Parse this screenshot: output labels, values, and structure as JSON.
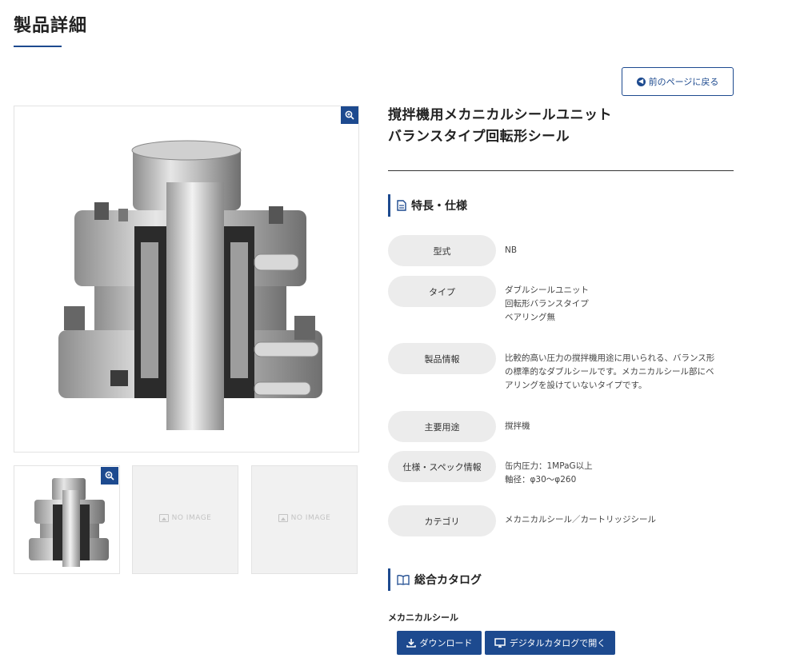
{
  "page": {
    "title": "製品詳細"
  },
  "back_button": {
    "label": "前のページに戻る"
  },
  "images": {
    "no_image_label": "NO IMAGE"
  },
  "product": {
    "name_line1": "撹拌機用メカニカルシールユニット",
    "name_line2": "バランスタイプ回転形シール"
  },
  "features": {
    "heading": "特長・仕様",
    "rows": [
      {
        "label": "型式",
        "value": "NB"
      },
      {
        "label": "タイプ",
        "value": "ダブルシールユニット\n回転形バランスタイプ\nベアリング無"
      },
      {
        "label": "製品情報",
        "value": "比較的高い圧力の撹拌機用途に用いられる、バランス形\nの標準的なダブルシールです。メカニカルシール部にベ\nアリングを設けていないタイプです。"
      },
      {
        "label": "主要用途",
        "value": "撹拌機"
      },
      {
        "label": "仕様・スペック情報",
        "value": "缶内圧力：1MPaG以上\n軸径：φ30〜φ260"
      },
      {
        "label": "カテゴリ",
        "value": "メカニカルシール／カートリッジシール"
      }
    ]
  },
  "catalog": {
    "heading": "総合カタログ",
    "subheading": "メカニカルシール",
    "download_label": "ダウンロード",
    "digital_label": "デジタルカタログで開く"
  },
  "colors": {
    "accent": "#1d4a8f",
    "label_bg": "#ececec",
    "placeholder_bg": "#f1f1f1"
  }
}
